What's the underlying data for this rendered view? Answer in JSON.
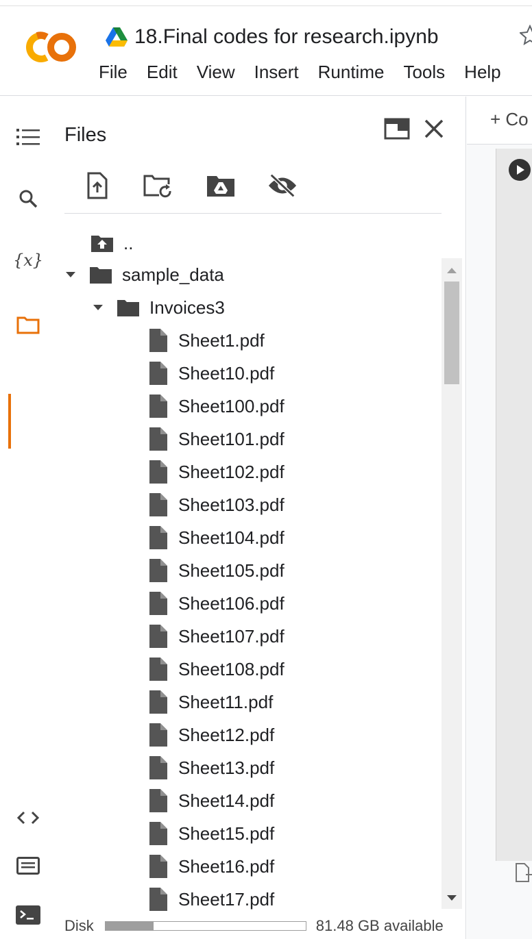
{
  "header": {
    "logo": "CO",
    "notebook_title": "18.Final codes for research.ipynb",
    "menu": [
      "File",
      "Edit",
      "View",
      "Insert",
      "Runtime",
      "Tools",
      "Help"
    ],
    "colors": {
      "logo": "#f9ab00",
      "logo_dark": "#e8710a",
      "active": "#e8710a"
    }
  },
  "rail": {
    "icons": [
      "toc-icon",
      "search-icon",
      "variables-icon",
      "folder-icon",
      "code-snippets-icon",
      "command-palette-icon",
      "terminal-icon"
    ],
    "variables_label": "{x}"
  },
  "files_panel": {
    "title": "Files",
    "toolbar": [
      "upload-file-icon",
      "refresh-icon",
      "mount-drive-icon",
      "hide-files-icon"
    ],
    "tree": [
      {
        "label": "..",
        "kind": "parent",
        "depth": 0
      },
      {
        "label": "sample_data",
        "kind": "folder",
        "depth": 0,
        "expanded": true
      },
      {
        "label": "Invoices3",
        "kind": "folder",
        "depth": 1,
        "expanded": true
      },
      {
        "label": "Sheet1.pdf",
        "kind": "file",
        "depth": 2
      },
      {
        "label": "Sheet10.pdf",
        "kind": "file",
        "depth": 2
      },
      {
        "label": "Sheet100.pdf",
        "kind": "file",
        "depth": 2
      },
      {
        "label": "Sheet101.pdf",
        "kind": "file",
        "depth": 2
      },
      {
        "label": "Sheet102.pdf",
        "kind": "file",
        "depth": 2
      },
      {
        "label": "Sheet103.pdf",
        "kind": "file",
        "depth": 2
      },
      {
        "label": "Sheet104.pdf",
        "kind": "file",
        "depth": 2
      },
      {
        "label": "Sheet105.pdf",
        "kind": "file",
        "depth": 2
      },
      {
        "label": "Sheet106.pdf",
        "kind": "file",
        "depth": 2
      },
      {
        "label": "Sheet107.pdf",
        "kind": "file",
        "depth": 2
      },
      {
        "label": "Sheet108.pdf",
        "kind": "file",
        "depth": 2
      },
      {
        "label": "Sheet11.pdf",
        "kind": "file",
        "depth": 2
      },
      {
        "label": "Sheet12.pdf",
        "kind": "file",
        "depth": 2
      },
      {
        "label": "Sheet13.pdf",
        "kind": "file",
        "depth": 2
      },
      {
        "label": "Sheet14.pdf",
        "kind": "file",
        "depth": 2
      },
      {
        "label": "Sheet15.pdf",
        "kind": "file",
        "depth": 2
      },
      {
        "label": "Sheet16.pdf",
        "kind": "file",
        "depth": 2
      },
      {
        "label": "Sheet17.pdf",
        "kind": "file",
        "depth": 2
      }
    ],
    "disk": {
      "label": "Disk",
      "available": "81.48 GB available",
      "used_fraction": 0.24
    }
  },
  "notebook": {
    "add_code_label": "+ Co"
  }
}
